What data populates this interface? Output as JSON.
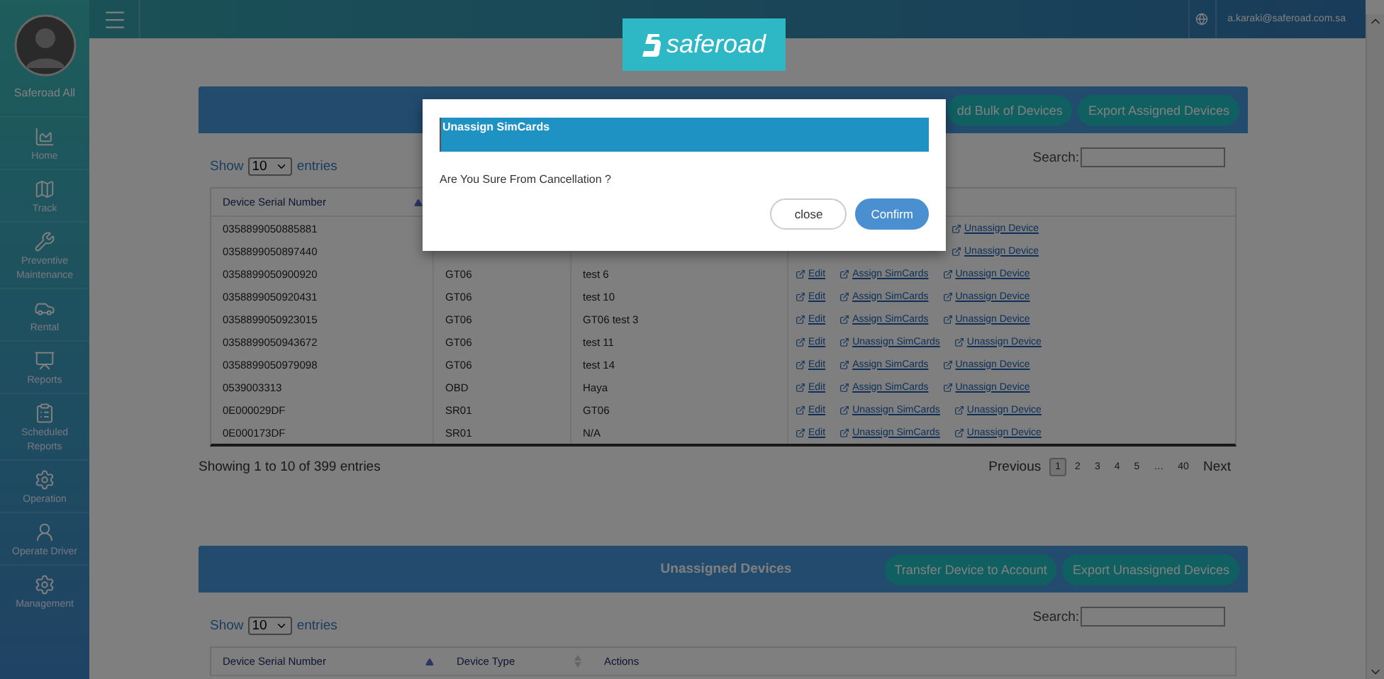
{
  "sidebar": {
    "user": "Saferoad All",
    "items": [
      {
        "label": "Home",
        "kind": "chart"
      },
      {
        "label": "Track",
        "kind": "map"
      },
      {
        "label": "Preventive Maintenance",
        "kind": "tools"
      },
      {
        "label": "Rental",
        "kind": "car"
      },
      {
        "label": "Reports",
        "kind": "board"
      },
      {
        "label": "Scheduled Reports",
        "kind": "clipboard"
      },
      {
        "label": "Operation",
        "kind": "gears"
      },
      {
        "label": "Operate Driver",
        "kind": "driver"
      },
      {
        "label": "Management",
        "kind": "gears"
      }
    ]
  },
  "topbar": {
    "user_email": "a.karaki@saferoad.com.sa"
  },
  "logo": "saferoad",
  "assigned_panel": {
    "buttons": [
      "dd Bulk of Devices",
      "Export Assigned Devices"
    ],
    "length": {
      "prefix": "Show",
      "value": "10",
      "suffix": "entries"
    },
    "search_label": "Search:",
    "columns": [
      {
        "label": "Device Serial Number",
        "sortable": true,
        "sorted": true
      }
    ],
    "rows": [
      {
        "serial": "0358899050885881",
        "actions": [
          {
            "label": "Unassign Device"
          }
        ]
      },
      {
        "serial": "0358899050897440",
        "actions": [
          {
            "label": "Unassign Device"
          }
        ]
      },
      {
        "serial": "0358899050900920",
        "type": "GT06",
        "name": "test 6",
        "actions": [
          {
            "label": "Edit"
          },
          {
            "label": "Assign SimCards"
          },
          {
            "label": "Unassign Device"
          }
        ]
      },
      {
        "serial": "0358899050920431",
        "type": "GT06",
        "name": "test 10",
        "actions": [
          {
            "label": "Edit"
          },
          {
            "label": "Assign SimCards"
          },
          {
            "label": "Unassign Device"
          }
        ]
      },
      {
        "serial": "0358899050923015",
        "type": "GT06",
        "name": "GT06 test 3",
        "actions": [
          {
            "label": "Edit"
          },
          {
            "label": "Assign SimCards"
          },
          {
            "label": "Unassign Device"
          }
        ]
      },
      {
        "serial": "0358899050943672",
        "type": "GT06",
        "name": "test 11",
        "actions": [
          {
            "label": "Edit"
          },
          {
            "label": "Unassign SimCards"
          },
          {
            "label": "Unassign Device"
          }
        ]
      },
      {
        "serial": "0358899050979098",
        "type": "GT06",
        "name": "test 14",
        "actions": [
          {
            "label": "Edit"
          },
          {
            "label": "Assign SimCards"
          },
          {
            "label": "Unassign Device"
          }
        ]
      },
      {
        "serial": "0539003313",
        "type": "OBD",
        "name": "Haya",
        "actions": [
          {
            "label": "Edit"
          },
          {
            "label": "Assign SimCards"
          },
          {
            "label": "Unassign Device"
          }
        ]
      },
      {
        "serial": "0E000029DF",
        "type": "SR01",
        "name": "GT06",
        "actions": [
          {
            "label": "Edit"
          },
          {
            "label": "Unassign SimCards"
          },
          {
            "label": "Unassign Device"
          }
        ]
      },
      {
        "serial": "0E000173DF",
        "type": "SR01",
        "name": "N/A",
        "actions": [
          {
            "label": "Edit"
          },
          {
            "label": "Unassign SimCards"
          },
          {
            "label": "Unassign Device"
          }
        ]
      }
    ],
    "info": "Showing 1 to 10 of 399 entries",
    "pagination": [
      {
        "label": "Previous",
        "selected": false
      },
      {
        "label": "1",
        "selected": true
      },
      {
        "label": "2",
        "selected": false
      },
      {
        "label": "3",
        "selected": false
      },
      {
        "label": "4",
        "selected": false
      },
      {
        "label": "5",
        "selected": false
      },
      {
        "label": "…",
        "selected": false
      },
      {
        "label": "40",
        "selected": false
      },
      {
        "label": "Next",
        "selected": false
      }
    ]
  },
  "unassigned_panel": {
    "title": "Unassigned Devices",
    "buttons": [
      "Transfer Device to Account",
      "Export Unassigned Devices"
    ],
    "length": {
      "prefix": "Show",
      "value": "10",
      "suffix": "entries"
    },
    "search_label": "Search:",
    "columns": [
      {
        "label": "Device Serial Number",
        "sortable": true,
        "sorted": true
      },
      {
        "label": "Device Type",
        "sortable": true,
        "sorted": false
      },
      {
        "label": "Actions",
        "sortable": false
      }
    ]
  },
  "dialog": {
    "title": "Unassign SimCards",
    "message": "Are You Sure From Cancellation ?",
    "buttons": [
      {
        "label": "close",
        "kind": "secondary"
      },
      {
        "label": "Confirm",
        "kind": "primary"
      }
    ]
  }
}
